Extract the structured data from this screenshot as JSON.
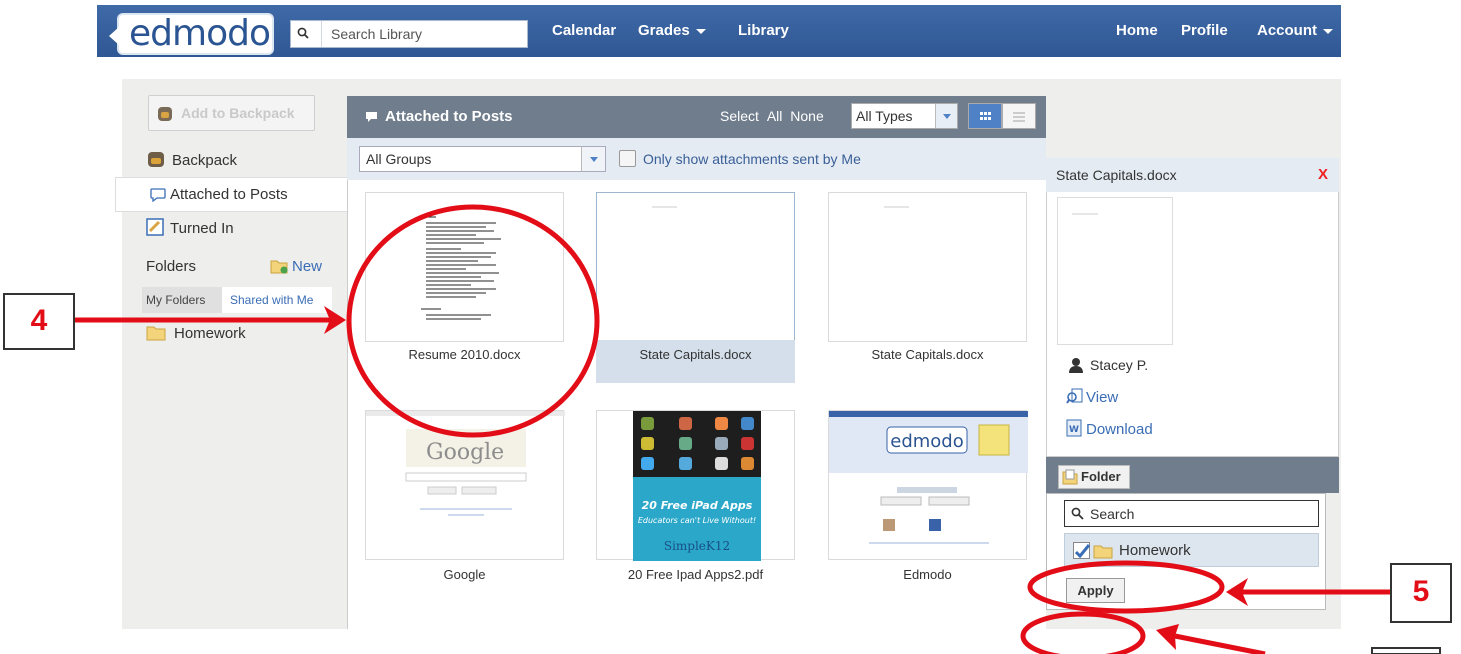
{
  "nav": {
    "logo": "edmodo",
    "search_placeholder": "Search Library",
    "links": [
      "Calendar",
      "Grades",
      "Library"
    ],
    "right_links": [
      "Home",
      "Profile",
      "Account"
    ]
  },
  "sidebar": {
    "add_to_backpack": "Add to Backpack",
    "items": [
      "Backpack",
      "Attached to Posts",
      "Turned In"
    ],
    "folders_label": "Folders",
    "new_label": "New",
    "tab_my": "My Folders",
    "tab_shared": "Shared with Me",
    "folder_homework": "Homework"
  },
  "main": {
    "title": "Attached to Posts",
    "select_label": "Select",
    "select_all": "All",
    "select_none": "None",
    "types_value": "All Types",
    "groups_value": "All Groups",
    "only_label": "Only show attachments sent by Me",
    "items": [
      {
        "name": "Resume 2010.docx"
      },
      {
        "name": "State Capitals.docx"
      },
      {
        "name": "State Capitals.docx"
      },
      {
        "name": "Google"
      },
      {
        "name": "20 Free Ipad Apps2.pdf"
      },
      {
        "name": "Edmodo"
      }
    ]
  },
  "detail": {
    "title": "State Capitals.docx",
    "close": "X",
    "user": "Stacey P.",
    "view": "View",
    "download": "Download",
    "folder_btn": "Folder",
    "search": "Search",
    "folder_item": "Homework",
    "apply": "Apply"
  },
  "annotations": {
    "step4": "4",
    "step5": "5"
  },
  "colors": {
    "nav": "#2f5793",
    "header_gray": "#6f7d8c",
    "annotation_red": "#e30d17"
  }
}
